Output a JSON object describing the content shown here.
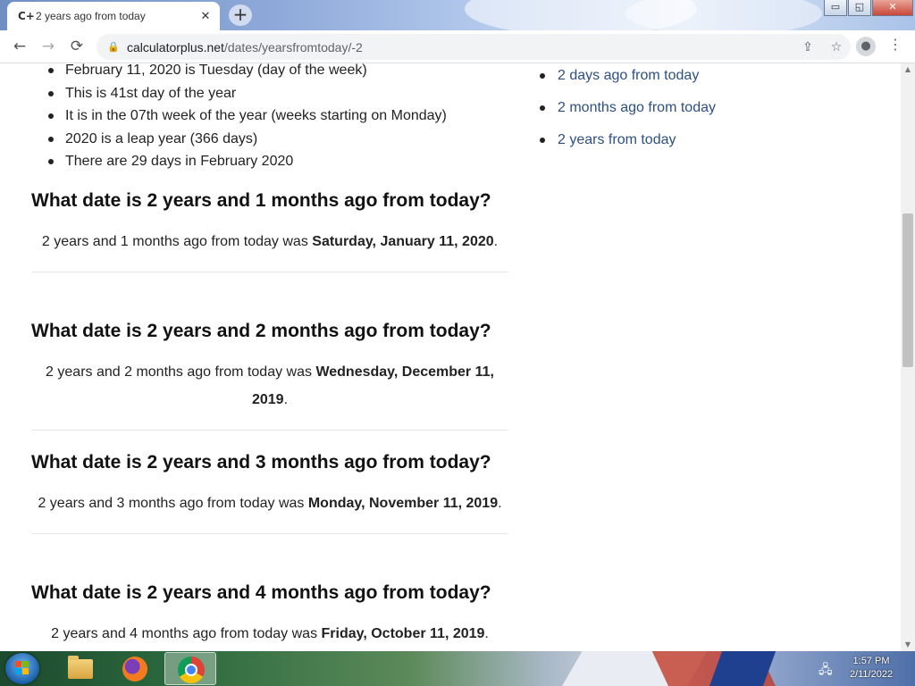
{
  "browser": {
    "tab_title": "2 years ago from today",
    "tab_favicon": "C+",
    "tab_close": "✕",
    "new_tab": "+",
    "window_buttons": {
      "minimize": "▭",
      "restore": "◱",
      "close": "✕"
    },
    "nav": {
      "back": "←",
      "forward": "→",
      "reload": "⟳"
    },
    "url_domain": "calculatorplus.net",
    "url_path": "/dates/yearsfromtoday/-2",
    "lock_icon": "🔒",
    "share_icon": "⇪",
    "bookmark_icon": "☆",
    "profile_icon": "●",
    "menu_icon": "⋮"
  },
  "facts": [
    "February 11, 2020 is Tuesday (day of the week)",
    "This is 41st day of the year",
    "It is in the 07th week of the year (weeks starting on Monday)",
    "2020 is a leap year (366 days)",
    "There are 29 days in February 2020"
  ],
  "sections": [
    {
      "heading": "What date is 2 years and 1 months ago from today?",
      "text": "2 years and 1 months ago from today was ",
      "date": "Saturday, January 11, 2020",
      "end": "."
    },
    {
      "heading": "What date is 2 years and 2 months ago from today?",
      "text": "2 years and 2 months ago from today was ",
      "date": "Wednesday, December 11, 2019",
      "end": "."
    },
    {
      "heading": "What date is 2 years and 3 months ago from today?",
      "text": "2 years and 3 months ago from today was ",
      "date": "Monday, November 11, 2019",
      "end": "."
    },
    {
      "heading": "What date is 2 years and 4 months ago from today?",
      "text": "2 years and 4 months ago from today was ",
      "date": "Friday, October 11, 2019",
      "end": "."
    }
  ],
  "sidebar_links": [
    "2 days ago from today",
    "2 months ago from today",
    "2 years from today"
  ],
  "scrollbar": {
    "up": "▲",
    "down": "▼"
  },
  "taskbar": {
    "clock_time": "1:57 PM",
    "clock_date": "2/11/2022",
    "tray_icon": "🖧"
  },
  "colors": {
    "link": "#2d4f82",
    "heading": "#111111"
  }
}
